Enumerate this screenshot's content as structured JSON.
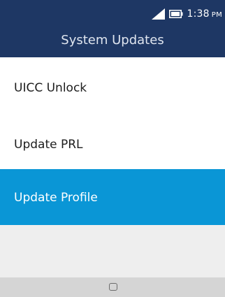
{
  "status_bar": {
    "time": "1:38",
    "ampm": "PM",
    "signal_icon": "signal-icon",
    "battery_icon": "battery-icon"
  },
  "header": {
    "title": "System Updates"
  },
  "menu": {
    "items": [
      {
        "label": "UICC Unlock",
        "selected": false
      },
      {
        "label": "Update PRL",
        "selected": false
      },
      {
        "label": "Update Profile",
        "selected": true
      }
    ]
  },
  "softkeys": {
    "center_icon": "select-icon"
  },
  "colors": {
    "header_bg": "#1e3764",
    "selected_bg": "#0a96d6",
    "softkey_bg": "#d5d5d5"
  }
}
